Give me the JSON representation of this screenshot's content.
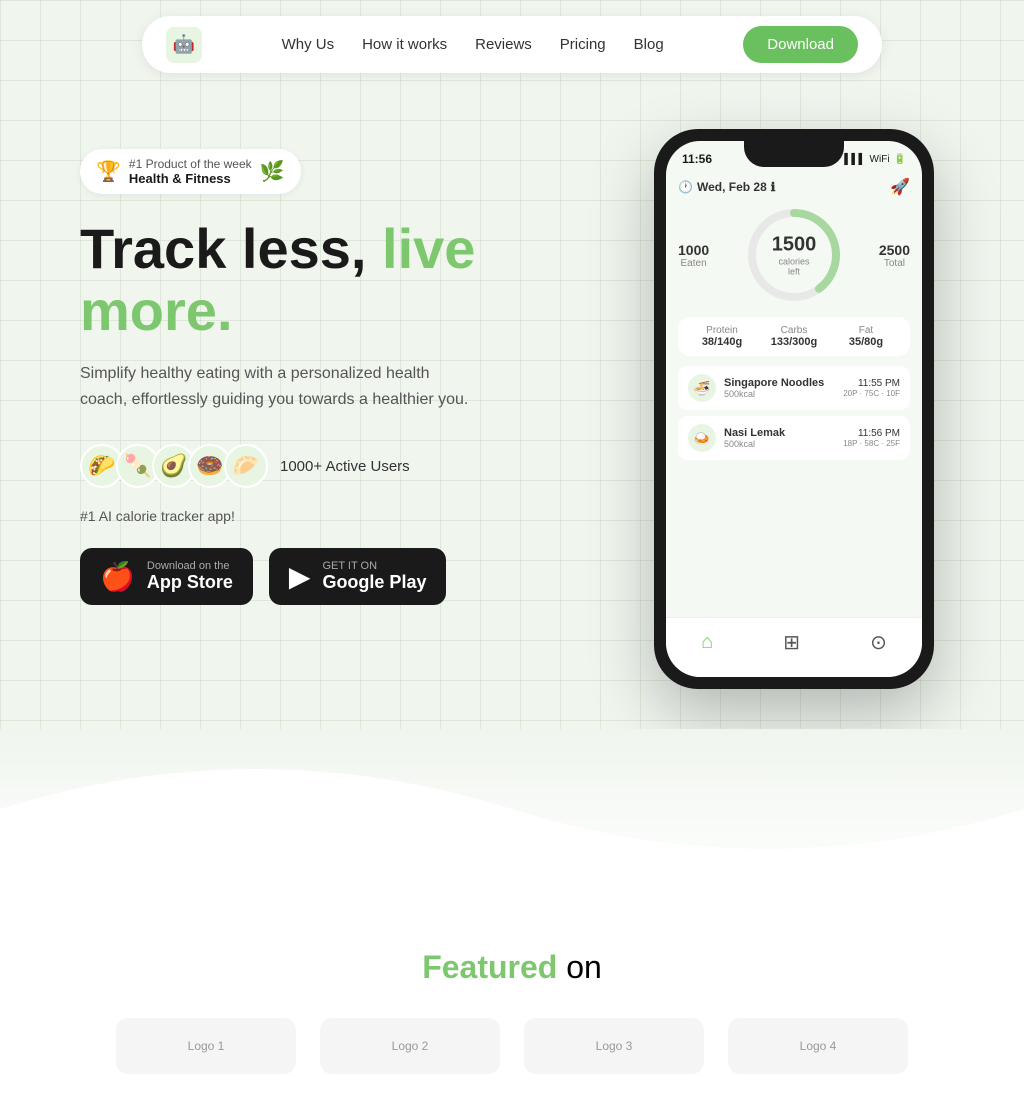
{
  "navbar": {
    "logo_icon": "🤖",
    "links": [
      {
        "label": "Why Us",
        "href": "#"
      },
      {
        "label": "How it works",
        "href": "#"
      },
      {
        "label": "Reviews",
        "href": "#"
      },
      {
        "label": "Pricing",
        "href": "#"
      },
      {
        "label": "Blog",
        "href": "#"
      }
    ],
    "download_label": "Download"
  },
  "hero": {
    "badge": {
      "rank": "#1 Product of the week",
      "category": "Health & Fitness"
    },
    "title_black": "Track less,",
    "title_green": "live more.",
    "subtitle": "Simplify healthy eating with a personalized health coach, effortlessly guiding you towards a healthier you.",
    "active_users_label": "1000+ Active Users",
    "ai_label": "#1 AI calorie tracker app!",
    "avatars": [
      "🌮",
      "🍡",
      "🥑",
      "🍩",
      "🥟"
    ],
    "app_store_label": "Download on the\nApp Store",
    "app_store_sub": "Download on the",
    "app_store_main": "App Store",
    "google_play_sub": "GET IT ON",
    "google_play_main": "Google Play"
  },
  "phone": {
    "time": "11:56",
    "date": "Wed, Feb 28",
    "calories_eaten": "1000",
    "calories_eaten_label": "Eaten",
    "calories_left": "1500",
    "calories_left_label": "calories\nleft",
    "calories_total": "2500",
    "calories_total_label": "Total",
    "macros": [
      {
        "name": "Protein",
        "value": "38/140g"
      },
      {
        "name": "Carbs",
        "value": "133/300g"
      },
      {
        "name": "Fat",
        "value": "35/80g"
      }
    ],
    "meals": [
      {
        "icon": "🍜",
        "name": "Singapore Noodles",
        "kcal": "500kcal",
        "time": "11:55 PM",
        "macros": "20P · 75C · 10F"
      },
      {
        "icon": "🍛",
        "name": "Nasi Lemak",
        "kcal": "500kcal",
        "time": "11:56 PM",
        "macros": "18P · 58C · 25F"
      }
    ]
  },
  "featured": {
    "title_green": "Featured",
    "title_black": "on"
  }
}
